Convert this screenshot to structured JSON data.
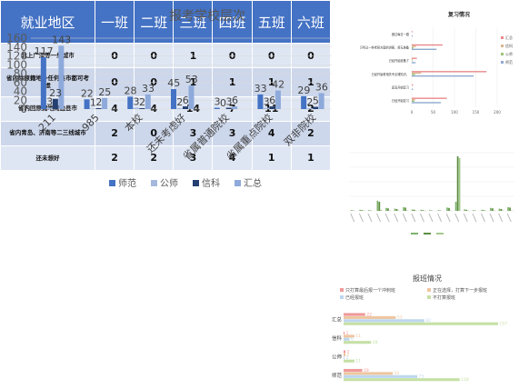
{
  "chart_data": [
    {
      "type": "bar",
      "title": "报考学校层次",
      "categories": [
        "211",
        "985",
        "本校",
        "还未考虑好",
        "省属普通院校",
        "省属重点院校",
        "双非院校"
      ],
      "series": [
        {
          "name": "师范",
          "values": [
            117,
            22,
            28,
            45,
            3,
            33,
            29
          ],
          "color": "#4472c4"
        },
        {
          "name": "公师",
          "values": [
            3,
            1,
            3,
            2,
            0,
            3,
            2
          ],
          "color": "#a5b8dd"
        },
        {
          "name": "信科",
          "values": [
            23,
            2,
            2,
            6,
            3,
            6,
            5
          ],
          "color": "#243f70"
        },
        {
          "name": "汇总",
          "values": [
            143,
            25,
            33,
            53,
            6,
            42,
            36
          ],
          "color": "#8eaadb"
        }
      ],
      "ylim": [
        0,
        160
      ],
      "yticks": [
        0,
        20,
        40,
        60,
        80,
        100,
        120,
        140,
        160
      ],
      "legend": "bottom"
    },
    {
      "type": "bar",
      "orientation": "horizontal",
      "title": "复习情况",
      "categories": [
        "已经开始复习",
        "还没开始复习",
        "已经开始看相关专业课知识，",
        "已经开始准备了",
        "只听过一些考研方面的讲座，暂无准备",
        "做过每日一题"
      ],
      "series": [
        {
          "name": "汇总",
          "values": [
            82,
            3,
            175,
            12,
            72,
            2
          ],
          "color": "#e9888a"
        },
        {
          "name": "信科",
          "values": [
            8,
            0,
            22,
            2,
            10,
            0
          ],
          "color": "#d9b38c"
        },
        {
          "name": "公师",
          "values": [
            6,
            0,
            8,
            1,
            4,
            0
          ],
          "color": "#9cc47a"
        },
        {
          "name": "师范",
          "values": [
            68,
            3,
            145,
            9,
            58,
            2
          ],
          "color": "#8ea9cf"
        }
      ],
      "xlim": [
        0,
        200
      ],
      "xticks": [
        0,
        50,
        100,
        150,
        200
      ],
      "legend": "right"
    },
    {
      "type": "bar",
      "title": "",
      "categories": [
        "c1",
        "c2",
        "c3",
        "c4",
        "c5",
        "c6",
        "c7",
        "c8",
        "c9",
        "c10",
        "c11",
        "c12",
        "c13",
        "c14",
        "c15",
        "c16",
        "c17",
        "c18",
        "c19"
      ],
      "series": [
        {
          "name": "",
          "values": [
            2,
            3,
            2,
            28,
            8,
            6,
            10,
            4,
            3,
            2,
            2,
            9,
            25,
            4,
            2,
            3,
            8,
            6,
            10
          ],
          "color": "#7eb16b"
        },
        {
          "name": "",
          "values": [
            1,
            2,
            1,
            25,
            7,
            5,
            9,
            3,
            2,
            1,
            1,
            8,
            150,
            3,
            1,
            2,
            7,
            5,
            9
          ],
          "color": "#5b8e3f"
        },
        {
          "name": "",
          "values": [
            0,
            1,
            0,
            3,
            1,
            1,
            1,
            1,
            1,
            0,
            0,
            1,
            145,
            1,
            0,
            1,
            1,
            1,
            1
          ],
          "color": "#a3c98d"
        }
      ],
      "ylim": [
        0,
        160
      ],
      "legend": "bottom"
    },
    {
      "type": "bar",
      "orientation": "horizontal",
      "title": "报班情况",
      "categories": [
        "汇总",
        "信科",
        "公师",
        "师范"
      ],
      "series": [
        {
          "name": "只打算最后报一个冲刺班",
          "values": [
            22,
            1,
            2,
            19
          ],
          "color": "#ef9a9a"
        },
        {
          "name": "正在选择，打算下一步报班",
          "values": [
            53,
            11,
            2,
            50
          ],
          "color": "#eec6a1"
        },
        {
          "name": "已经报班",
          "values": [
            82,
            6,
            1,
            75
          ],
          "color": "#bdd7ee"
        },
        {
          "name": "不打算报班",
          "values": [
            157,
            28,
            11,
            118
          ],
          "color": "#c5e0a5"
        }
      ],
      "xlim": [
        0,
        170
      ],
      "legend": "top"
    }
  ],
  "employment": {
    "headers": [
      "就业地区",
      "一班",
      "二班",
      "三班",
      "四班",
      "五班",
      "六班"
    ],
    "rows": [
      {
        "label": "北上广深等一线城市",
        "values": [
          "0",
          "0",
          "1",
          "0",
          "0",
          "0"
        ]
      },
      {
        "label": "省内除原籍地外任何县市都可考虑",
        "values": [
          "0",
          "0",
          "1",
          "1",
          "1",
          "1"
        ]
      },
      {
        "label": "省内回原籍地周边县市",
        "values": [
          "4",
          "4",
          "14",
          "7",
          "11",
          "2"
        ]
      },
      {
        "label": "省内青岛、济南等二三线城市",
        "values": [
          "2",
          "0",
          "3",
          "3",
          "4",
          "2"
        ]
      },
      {
        "label": "还未想好",
        "values": [
          "2",
          "2",
          "3",
          "4",
          "1",
          "1"
        ]
      }
    ]
  }
}
